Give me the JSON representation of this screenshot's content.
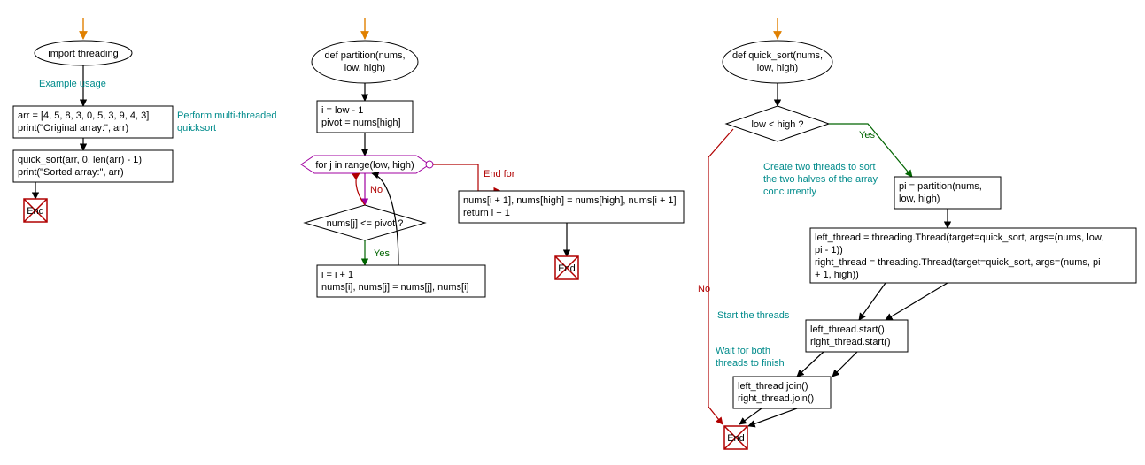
{
  "flowchart1": {
    "start_box": "import threading",
    "comment1": "Example usage",
    "box2_line1": "arr = [4, 5, 8, 3, 0, 5, 3, 9, 4, 3]",
    "box2_line2": "print(\"Original array:\", arr)",
    "comment2a": "Perform multi-threaded",
    "comment2b": "quicksort",
    "box3_line1": "quick_sort(arr, 0, len(arr) - 1)",
    "box3_line2": "print(\"Sorted array:\", arr)",
    "end": "End"
  },
  "flowchart2": {
    "start_line1": "def partition(nums,",
    "start_line2": "low, high)",
    "box2_line1": "i = low - 1",
    "box2_line2": "pivot = nums[high]",
    "loop": "for j in range(low, high)",
    "end_for": "End for",
    "decision": "nums[j] <= pivot ?",
    "yes": "Yes",
    "no": "No",
    "box_swap_line1": "i = i + 1",
    "box_swap_line2": "nums[i], nums[j] = nums[j], nums[i]",
    "box_ret_line1": "nums[i + 1], nums[high] = nums[high], nums[i + 1]",
    "box_ret_line2": "return i + 1",
    "end": "End"
  },
  "flowchart3": {
    "start_line1": "def quick_sort(nums,",
    "start_line2": "low, high)",
    "decision": "low < high ?",
    "yes": "Yes",
    "no": "No",
    "comment1a": "Create two threads to sort",
    "comment1b": "the two halves of the array",
    "comment1c": "concurrently",
    "box_pi_line1": "pi = partition(nums,",
    "box_pi_line2": "low, high)",
    "box_threads_line1": "left_thread = threading.Thread(target=quick_sort, args=(nums, low,",
    "box_threads_line2": "pi - 1))",
    "box_threads_line3": "right_thread = threading.Thread(target=quick_sort, args=(nums, pi",
    "box_threads_line4": "+ 1, high))",
    "comment2": "Start the threads",
    "box_start_line1": "left_thread.start()",
    "box_start_line2": "right_thread.start()",
    "comment3a": "Wait for both",
    "comment3b": "threads to finish",
    "box_join_line1": "left_thread.join()",
    "box_join_line2": "right_thread.join()",
    "end": "End"
  }
}
